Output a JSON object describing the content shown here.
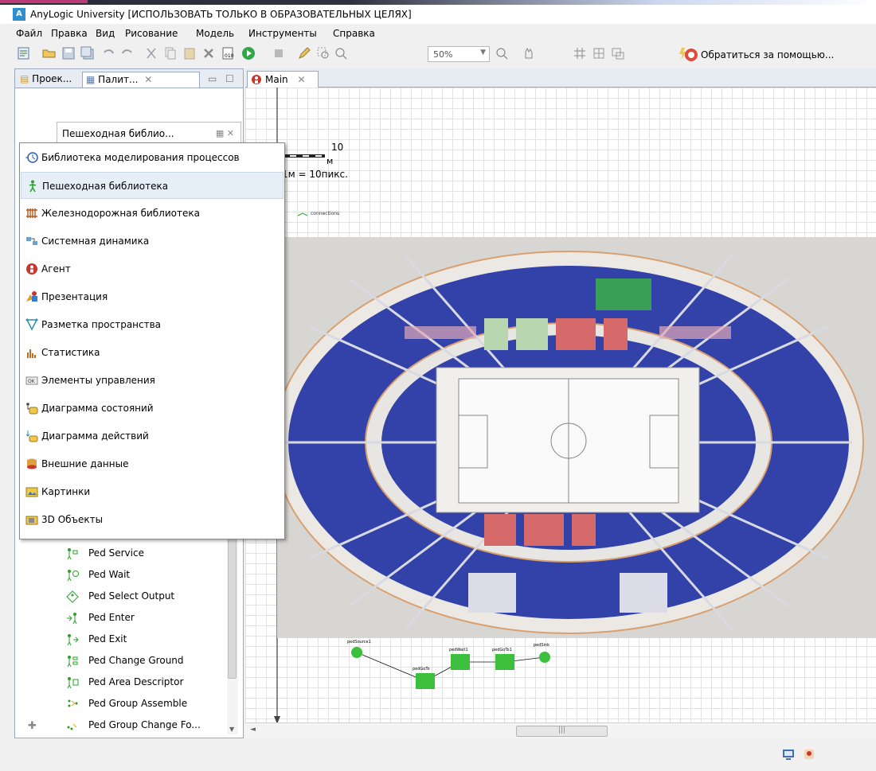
{
  "window": {
    "title": "AnyLogic University [ИСПОЛЬЗОВАТЬ ТОЛЬКО В ОБРАЗОВАТЕЛЬНЫХ ЦЕЛЯХ]"
  },
  "menu": [
    "Файл",
    "Правка",
    "Вид",
    "Рисование",
    "Модель",
    "Инструменты",
    "Справка"
  ],
  "toolbar": {
    "zoom": "50%",
    "help": "Обратиться за помощью..."
  },
  "left_panel": {
    "tabs": [
      "Проек...",
      "Палит..."
    ],
    "sub_panel": "Пешеходная библио...",
    "items": [
      "Ped Service",
      "Ped Wait",
      "Ped Select Output",
      "Ped Enter",
      "Ped Exit",
      "Ped Change Ground",
      "Ped Area Descriptor",
      "Ped Group Assemble",
      "Ped Group Change Fo..."
    ]
  },
  "dropdown": {
    "selected_index": 1,
    "items": [
      {
        "label": "Библиотека моделирования процессов",
        "icon": "process-icon"
      },
      {
        "label": "Пешеходная библиотека",
        "icon": "pedestrian-icon"
      },
      {
        "label": "Железнодорожная библиотека",
        "icon": "rail-icon"
      },
      {
        "label": "Системная динамика",
        "icon": "system-dynamics-icon"
      },
      {
        "label": "Агент",
        "icon": "agent-icon"
      },
      {
        "label": "Презентация",
        "icon": "presentation-icon"
      },
      {
        "label": "Разметка пространства",
        "icon": "space-markup-icon"
      },
      {
        "label": "Статистика",
        "icon": "statistics-icon"
      },
      {
        "label": "Элементы управления",
        "icon": "controls-icon"
      },
      {
        "label": "Диаграмма состояний",
        "icon": "statechart-icon"
      },
      {
        "label": "Диаграмма действий",
        "icon": "action-chart-icon"
      },
      {
        "label": "Внешние данные",
        "icon": "external-data-icon"
      },
      {
        "label": "Картинки",
        "icon": "pictures-icon"
      },
      {
        "label": "3D Объекты",
        "icon": "3d-objects-icon"
      }
    ]
  },
  "editor": {
    "tab": "Main",
    "scale_value": "10",
    "scale_unit": "м",
    "scale_ratio": "1м = 10пикс.",
    "connections_label": "connections",
    "flow_nodes": [
      "pedSource1",
      "pedGoTo",
      "pedWait1",
      "pedGoTo1",
      "pedSink"
    ]
  },
  "colors": {
    "accent": "#2f8fce",
    "blue_seats": "#2f3fa6",
    "red_seats": "#d66a6a",
    "green_block": "#3cbf3c"
  }
}
